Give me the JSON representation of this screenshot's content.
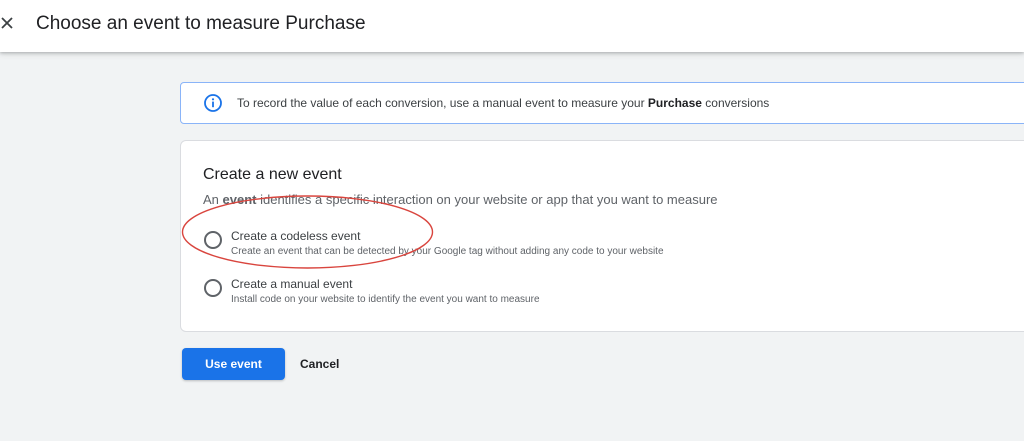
{
  "header": {
    "close_icon": "close-icon",
    "title": "Choose an event to measure Purchase"
  },
  "info_banner": {
    "icon": "info-icon",
    "text_before": "To record the value of each conversion, use a manual event to measure your ",
    "text_bold": "Purchase",
    "text_after": " conversions",
    "accent_color": "#1a73e8"
  },
  "card": {
    "title": "Create a new event",
    "desc_before": "An ",
    "desc_bold": "event",
    "desc_after": " identifies a specific interaction on your website or app that you want to measure",
    "options": [
      {
        "label": "Create a codeless event",
        "description": "Create an event that can be detected by your Google tag without adding any code to your website",
        "selected": false
      },
      {
        "label": "Create a manual event",
        "description": "Install code on your website to identify the event you want to measure",
        "selected": false
      }
    ]
  },
  "annotation": {
    "shape": "oval",
    "color": "#d9453e",
    "target": "Create a codeless event"
  },
  "actions": {
    "primary_label": "Use event",
    "primary_color": "#1a73e8",
    "secondary_label": "Cancel"
  }
}
